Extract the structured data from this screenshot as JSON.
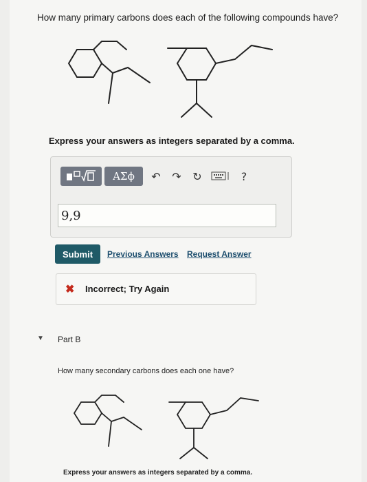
{
  "question": "How many primary carbons does each of the following compounds have?",
  "instruction": "Express your answers as integers separated by a comma.",
  "toolbar": {
    "templates_icon": "templates-icon",
    "greek_label": "ΑΣϕ",
    "undo_icon": "undo-icon",
    "redo_icon": "redo-icon",
    "reset_icon": "reset-icon",
    "keyboard_icon": "keyboard-icon",
    "help_label": "?"
  },
  "answer": {
    "value": "9,9"
  },
  "submit_label": "Submit",
  "links": {
    "previous": "Previous Answers",
    "request": "Request Answer"
  },
  "feedback": {
    "icon": "x-icon",
    "text": "Incorrect; Try Again"
  },
  "part_b": {
    "label": "Part B",
    "question": "How many secondary carbons does each one have?",
    "instruction": "Express your answers as integers separated by a comma."
  },
  "colors": {
    "submit": "#1f5a67",
    "link": "#1d4e6e",
    "incorrect": "#c42a1c",
    "toolbar_button": "#707682"
  }
}
